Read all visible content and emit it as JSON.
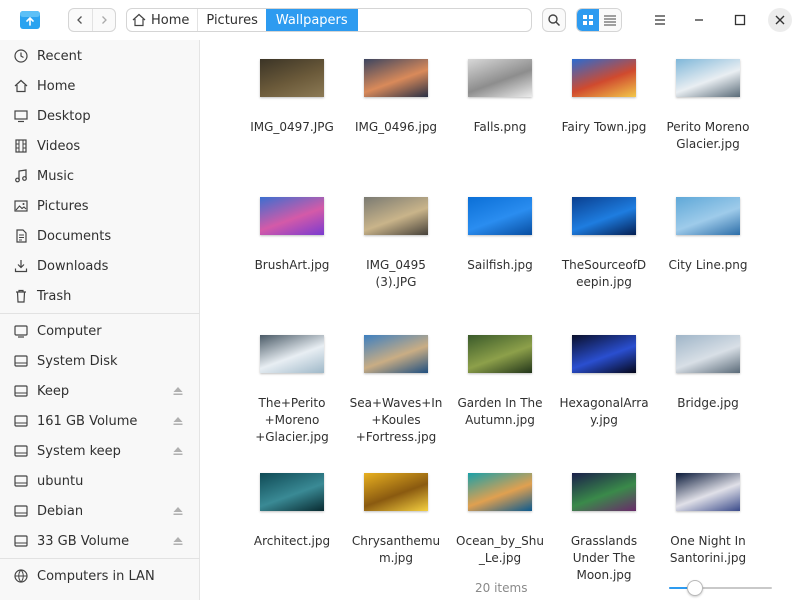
{
  "window": {
    "app_icon": "file-manager-icon",
    "controls": [
      "menu-icon",
      "minimize-icon",
      "maximize-icon",
      "close-icon"
    ]
  },
  "breadcrumb": {
    "items": [
      "Home",
      "Pictures",
      "Wallpapers"
    ],
    "active": "Wallpapers"
  },
  "view": {
    "mode": "icon"
  },
  "sidebar": {
    "items": [
      {
        "label": "Recent",
        "icon": "clock-icon"
      },
      {
        "label": "Home",
        "icon": "home-icon"
      },
      {
        "label": "Desktop",
        "icon": "desktop-icon"
      },
      {
        "label": "Videos",
        "icon": "film-icon"
      },
      {
        "label": "Music",
        "icon": "music-icon"
      },
      {
        "label": "Pictures",
        "icon": "picture-icon"
      },
      {
        "label": "Documents",
        "icon": "document-icon"
      },
      {
        "label": "Downloads",
        "icon": "download-icon"
      },
      {
        "label": "Trash",
        "icon": "trash-icon"
      }
    ],
    "devices": [
      {
        "label": "Computer",
        "icon": "computer-icon",
        "ejectable": false
      },
      {
        "label": "System Disk",
        "icon": "disk-icon",
        "ejectable": false
      },
      {
        "label": "Keep",
        "icon": "disk-icon",
        "ejectable": true
      },
      {
        "label": "161 GB Volume",
        "icon": "disk-icon",
        "ejectable": true
      },
      {
        "label": "System keep",
        "icon": "disk-icon",
        "ejectable": true
      },
      {
        "label": "ubuntu",
        "icon": "disk-icon",
        "ejectable": false
      },
      {
        "label": "Debian",
        "icon": "disk-icon",
        "ejectable": true
      },
      {
        "label": "33 GB Volume",
        "icon": "disk-icon",
        "ejectable": true
      }
    ],
    "network": [
      {
        "label": "Computers in LAN",
        "icon": "network-icon"
      }
    ]
  },
  "files": [
    {
      "name": "IMG_0497.JPG",
      "lines": [
        "IMG_0497.JPG"
      ],
      "colors": [
        "#3b3426",
        "#6b5a3a",
        "#8c7a55"
      ]
    },
    {
      "name": "IMG_0496.jpg",
      "lines": [
        "IMG_0496.jpg"
      ],
      "colors": [
        "#3c4560",
        "#d98a5a",
        "#2a3146"
      ]
    },
    {
      "name": "Falls.png",
      "lines": [
        "Falls.png"
      ],
      "colors": [
        "#d8d8d8",
        "#8d8d8d",
        "#ececec"
      ]
    },
    {
      "name": "Fairy Town.jpg",
      "lines": [
        "Fairy Town.jpg"
      ],
      "colors": [
        "#2a6bd1",
        "#d04a2e",
        "#f2c84a"
      ]
    },
    {
      "name": "Perito Moreno Glacier.jpg",
      "lines": [
        "Perito Moreno",
        "Glacier.jpg"
      ],
      "colors": [
        "#7fb7d9",
        "#e9eef2",
        "#5a6b78"
      ]
    },
    {
      "name": "BrushArt.jpg",
      "lines": [
        "BrushArt.jpg"
      ],
      "colors": [
        "#3b6fd0",
        "#d45aa8",
        "#7a3bd0"
      ]
    },
    {
      "name": "IMG_0495 (3).JPG",
      "lines": [
        "IMG_0495",
        "(3).JPG"
      ],
      "colors": [
        "#7a7a72",
        "#c9b48a",
        "#46413a"
      ]
    },
    {
      "name": "Sailfish.jpg",
      "lines": [
        "Sailfish.jpg"
      ],
      "colors": [
        "#0b6fd6",
        "#2a8df0",
        "#084da0"
      ]
    },
    {
      "name": "TheSourceofDeepin.jpg",
      "lines": [
        "TheSourceofD",
        "eepin.jpg"
      ],
      "colors": [
        "#0a3f8f",
        "#1e7de0",
        "#051f52"
      ]
    },
    {
      "name": "City Line.png",
      "lines": [
        "City Line.png"
      ],
      "colors": [
        "#5fa8d8",
        "#9ecbea",
        "#2d6ea8"
      ]
    },
    {
      "name": "The+Perito+Moreno+Glacier.jpg",
      "lines": [
        "The+Perito",
        "+Moreno",
        "+Glacier.jpg"
      ],
      "colors": [
        "#4a5a66",
        "#e8eef3",
        "#9fb8c8"
      ]
    },
    {
      "name": "Sea+Waves+In+Koules+Fortress.jpg",
      "lines": [
        "Sea+Waves+In",
        "+Koules",
        "+Fortress.jpg"
      ],
      "colors": [
        "#3d7fc0",
        "#c9ad84",
        "#1f4f80"
      ]
    },
    {
      "name": "Garden In The Autumn.jpg",
      "lines": [
        "Garden In The",
        "Autumn.jpg"
      ],
      "colors": [
        "#3a5a2a",
        "#8da04a",
        "#22351a"
      ]
    },
    {
      "name": "HexagonalArray.jpg",
      "lines": [
        "HexagonalArra",
        "y.jpg"
      ],
      "colors": [
        "#0a0f2a",
        "#2a4fd0",
        "#05071a"
      ]
    },
    {
      "name": "Bridge.jpg",
      "lines": [
        "Bridge.jpg"
      ],
      "colors": [
        "#9fb5c8",
        "#d8dfe6",
        "#5a6a78"
      ]
    },
    {
      "name": "Architect.jpg",
      "lines": [
        "Architect.jpg"
      ],
      "colors": [
        "#0f4a55",
        "#3a8a95",
        "#082a30"
      ]
    },
    {
      "name": "Chrysanthemum.jpg",
      "lines": [
        "Chrysanthemu",
        "m.jpg"
      ],
      "colors": [
        "#e8b020",
        "#8a5a10",
        "#f5d040"
      ]
    },
    {
      "name": "Ocean_by_Shu_Le.jpg",
      "lines": [
        "Ocean_by_Shu",
        "_Le.jpg"
      ],
      "colors": [
        "#1aa0a8",
        "#e0a050",
        "#0a5a90"
      ]
    },
    {
      "name": "Grasslands Under The Moon.jpg",
      "lines": [
        "Grasslands",
        "Under The",
        "Moon.jpg"
      ],
      "colors": [
        "#1a1f4a",
        "#3a8a4a",
        "#6a2a6a"
      ]
    },
    {
      "name": "One Night In Santorini.jpg",
      "lines": [
        "One Night In",
        "Santorini.jpg"
      ],
      "colors": [
        "#0a1a3a",
        "#e0e0e8",
        "#3a4a8a"
      ]
    }
  ],
  "status": {
    "count_text": "20 items"
  },
  "zoom": {
    "level": 0.25
  }
}
